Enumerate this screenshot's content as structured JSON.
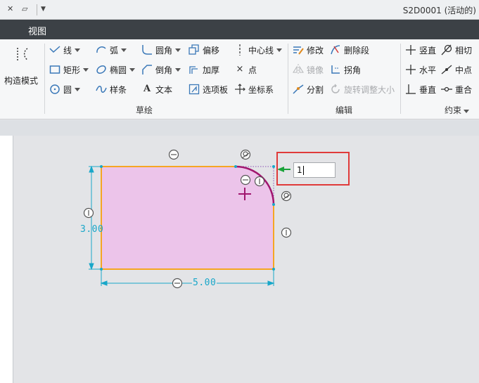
{
  "titlebar": {
    "quick_access": [
      "x-glyph",
      "layer-glyph",
      "dropdown"
    ],
    "title": "S2D0001 (活动的)"
  },
  "tabbar": {
    "active_tab": "视图"
  },
  "ribbon": {
    "setup": {
      "label": "构造模式"
    },
    "sketch_group": {
      "label": "草绘",
      "items": [
        {
          "label": "线",
          "icon": "line-icon",
          "dropdown": true
        },
        {
          "label": "弧",
          "icon": "arc-icon",
          "dropdown": true
        },
        {
          "label": "圆角",
          "icon": "fillet-icon",
          "dropdown": true
        },
        {
          "label": "偏移",
          "icon": "offset-icon"
        },
        {
          "label": "中心线",
          "icon": "centerline-icon",
          "dropdown": true
        },
        {
          "label": "矩形",
          "icon": "rectangle-icon",
          "dropdown": true
        },
        {
          "label": "椭圆",
          "icon": "ellipse-icon",
          "dropdown": true
        },
        {
          "label": "倒角",
          "icon": "chamfer-icon",
          "dropdown": true
        },
        {
          "label": "加厚",
          "icon": "thicken-icon"
        },
        {
          "label": "点",
          "icon": "point-icon"
        },
        {
          "label": "圆",
          "icon": "circle-icon",
          "dropdown": true
        },
        {
          "label": "样条",
          "icon": "spline-icon"
        },
        {
          "label": "文本",
          "icon": "text-icon"
        },
        {
          "label": "选项板",
          "icon": "palette-icon"
        },
        {
          "label": "坐标系",
          "icon": "coordinate-system-icon"
        }
      ]
    },
    "edit_group": {
      "label": "编辑",
      "items": [
        {
          "label": "修改",
          "icon": "modify-icon",
          "enabled": true
        },
        {
          "label": "删除段",
          "icon": "delete-segment-icon",
          "enabled": true
        },
        {
          "label": "镜像",
          "icon": "mirror-icon",
          "enabled": false
        },
        {
          "label": "拐角",
          "icon": "corner-icon",
          "enabled": true
        },
        {
          "label": "分割",
          "icon": "divide-icon",
          "enabled": true
        },
        {
          "label": "旋转调整大小",
          "icon": "rotate-resize-icon",
          "enabled": false
        }
      ]
    },
    "constrain_group": {
      "label": "约束",
      "items": [
        {
          "label": "竖直",
          "icon": "vertical-icon"
        },
        {
          "label": "相切",
          "icon": "tangent-icon"
        },
        {
          "label": "水平",
          "icon": "horizontal-icon"
        },
        {
          "label": "中点",
          "icon": "midpoint-icon"
        },
        {
          "label": "垂直",
          "icon": "perpendicular-icon"
        },
        {
          "label": "重合",
          "icon": "coincident-icon"
        }
      ]
    }
  },
  "canvas": {
    "dimensions": {
      "height": "3.00",
      "width": "5.00"
    },
    "dimension_input": {
      "value": "1"
    },
    "colors": {
      "rectangle_fill": "#ecc4ea",
      "rectangle_edge": "#f5a623",
      "arc": "#a0166e",
      "dimension": "#19a7c9",
      "input_highlight": "#e03a3a",
      "cursor": "#a0166e"
    }
  }
}
